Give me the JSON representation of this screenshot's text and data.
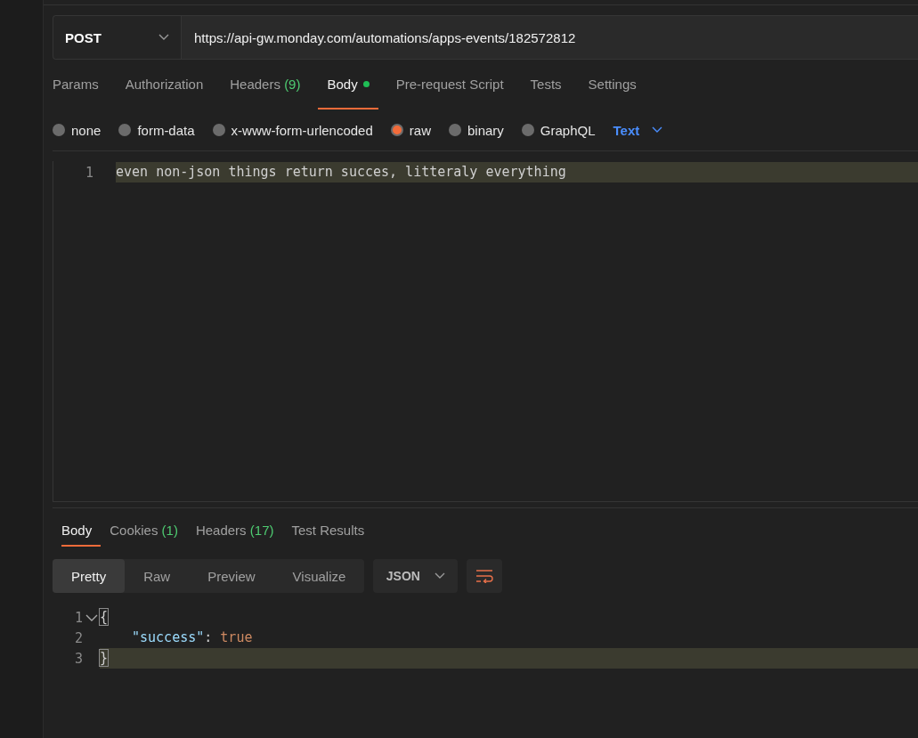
{
  "request": {
    "method": "POST",
    "url": "https://api-gw.monday.com/automations/apps-events/182572812"
  },
  "request_tabs": [
    {
      "label": "Params",
      "selected": false
    },
    {
      "label": "Authorization",
      "selected": false
    },
    {
      "label": "Headers",
      "count": "(9)",
      "selected": false
    },
    {
      "label": "Body",
      "selected": true,
      "modified": true
    },
    {
      "label": "Pre-request Script",
      "selected": false
    },
    {
      "label": "Tests",
      "selected": false
    },
    {
      "label": "Settings",
      "selected": false
    }
  ],
  "body_types": [
    {
      "label": "none",
      "selected": false
    },
    {
      "label": "form-data",
      "selected": false
    },
    {
      "label": "x-www-form-urlencoded",
      "selected": false
    },
    {
      "label": "raw",
      "selected": true
    },
    {
      "label": "binary",
      "selected": false
    },
    {
      "label": "GraphQL",
      "selected": false
    }
  ],
  "body_format": "Text",
  "editor": {
    "lines": [
      {
        "number": "1",
        "text": "even non-json things return succes, litteraly everything",
        "highlighted": true
      }
    ]
  },
  "response_tabs": [
    {
      "label": "Body",
      "selected": true
    },
    {
      "label": "Cookies",
      "count": "(1)",
      "selected": false
    },
    {
      "label": "Headers",
      "count": "(17)",
      "selected": false
    },
    {
      "label": "Test Results",
      "selected": false
    }
  ],
  "view_modes": [
    {
      "label": "Pretty",
      "selected": true
    },
    {
      "label": "Raw",
      "selected": false
    },
    {
      "label": "Preview",
      "selected": false
    },
    {
      "label": "Visualize",
      "selected": false
    }
  ],
  "response_format": "JSON",
  "response_lines": [
    {
      "number": "1",
      "foldable": true,
      "highlighted": false,
      "tokens": [
        {
          "kind": "bracket",
          "text": "{"
        }
      ],
      "children": [
        {
          "number": "2",
          "foldable": false,
          "highlighted": false,
          "tokens": [
            {
              "kind": "key",
              "text": "\"success\""
            },
            {
              "kind": "punct",
              "text": ": "
            },
            {
              "kind": "bool",
              "text": "true"
            }
          ]
        }
      ]
    },
    {
      "number": "3",
      "foldable": false,
      "highlighted": true,
      "tokens": [
        {
          "kind": "bracket",
          "text": "}"
        }
      ]
    }
  ]
}
